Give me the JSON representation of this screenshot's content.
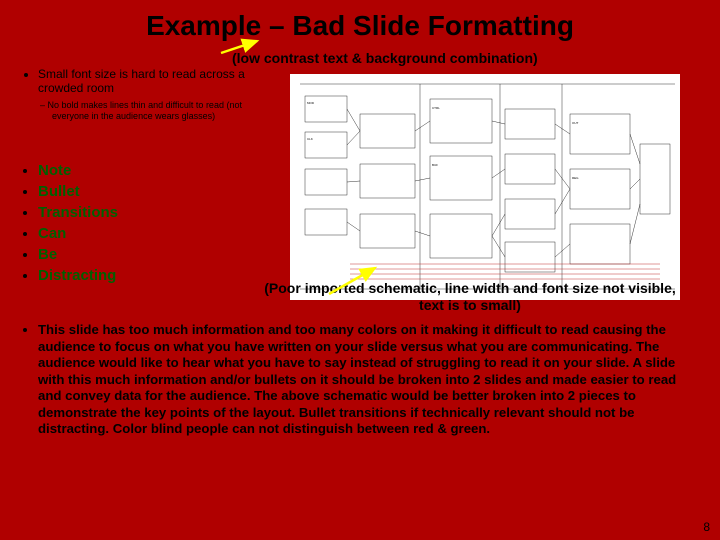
{
  "title": "Example – Bad Slide Formatting",
  "subtitle": "(low contrast text & background combination)",
  "first_bullet": "Small font size is hard to read across a crowded room",
  "sub_bullet": "No bold makes lines thin and difficult to read (not everyone in the audience wears glasses)",
  "green_bullets": [
    "Note",
    "Bullet",
    "Transitions",
    "Can",
    "Be",
    "Distracting"
  ],
  "poor_schematic": "(Poor imported schematic, line width and font size not visible, text is to small)",
  "paragraph": "This slide has too much information and too many colors on it making it difficult to read causing the audience to focus on what you have written on your slide versus what you are communicating.  The audience would like to hear what you have to say instead of struggling to read it on your slide.  A slide with this much information and/or bullets on it should be broken into 2 slides and made easier to read and convey data for the audience.   The above schematic would be better broken into 2 pieces to demonstrate the key points of the layout.  Bullet transitions if technically relevant should not be distracting.  Color blind people can not distinguish between red & green.",
  "page_number": "8"
}
